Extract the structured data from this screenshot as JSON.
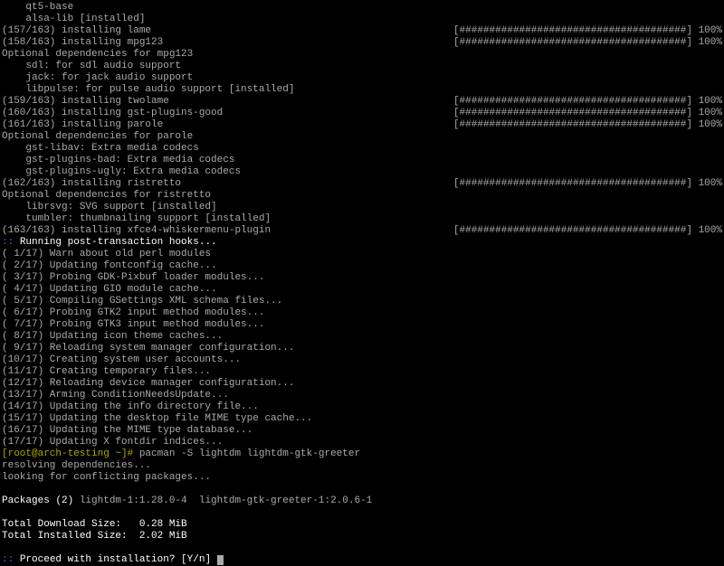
{
  "lines": {
    "qt5_base": "    qt5-base",
    "alsa_lib": "    alsa-lib [installed]",
    "inst_157": "(157/163) installing lame",
    "inst_158": "(158/163) installing mpg123",
    "opt_mpg123": "Optional dependencies for mpg123",
    "mpg123_sdl": "    sdl: for sdl audio support",
    "mpg123_jack": "    jack: for jack audio support",
    "mpg123_libpulse": "    libpulse: for pulse audio support [installed]",
    "inst_159": "(159/163) installing twolame",
    "inst_160": "(160/163) installing gst-plugins-good",
    "inst_161": "(161/163) installing parole",
    "opt_parole": "Optional dependencies for parole",
    "parole_libav": "    gst-libav: Extra media codecs",
    "parole_bad": "    gst-plugins-bad: Extra media codecs",
    "parole_ugly": "    gst-plugins-ugly: Extra media codecs",
    "inst_162": "(162/163) installing ristretto",
    "opt_ristretto": "Optional dependencies for ristretto",
    "ristretto_librsvg": "    librsvg: SVG support [installed]",
    "ristretto_tumbler": "    tumbler: thumbnailing support [installed]",
    "inst_163": "(163/163) installing xfce4-whiskermenu-plugin",
    "hooks_header_prefix": ":: ",
    "hooks_header_text": "Running post-transaction hooks...",
    "hook01": "( 1/17) Warn about old perl modules",
    "hook02": "( 2/17) Updating fontconfig cache...",
    "hook03": "( 3/17) Probing GDK-Pixbuf loader modules...",
    "hook04": "( 4/17) Updating GIO module cache...",
    "hook05": "( 5/17) Compiling GSettings XML schema files...",
    "hook06": "( 6/17) Probing GTK2 input method modules...",
    "hook07": "( 7/17) Probing GTK3 input method modules...",
    "hook08": "( 8/17) Updating icon theme caches...",
    "hook09": "( 9/17) Reloading system manager configuration...",
    "hook10": "(10/17) Creating system user accounts...",
    "hook11": "(11/17) Creating temporary files...",
    "hook12": "(12/17) Reloading device manager configuration...",
    "hook13": "(13/17) Arming ConditionNeedsUpdate...",
    "hook14": "(14/17) Updating the info directory file...",
    "hook15": "(15/17) Updating the desktop file MIME type cache...",
    "hook16": "(16/17) Updating the MIME type database...",
    "hook17": "(17/17) Updating X fontdir indices...",
    "prompt_prefix": "[root@arch-testing ~]# ",
    "cmd_text": "pacman -S lightdm lightdm-gtk-greeter",
    "resolving": "resolving dependencies...",
    "conflicts": "looking for conflicting packages...",
    "packages_label": "Packages (2)",
    "packages_list": " lightdm-1:1.28.0-4  lightdm-gtk-greeter-1:2.0.6-1",
    "dl_size": "Total Download Size:   0.28 MiB",
    "inst_size": "Total Installed Size:  2.02 MiB",
    "proceed_prefix": ":: ",
    "proceed_text": "Proceed with installation? [Y/n] "
  },
  "progress_bar": "[######################################] 100%"
}
